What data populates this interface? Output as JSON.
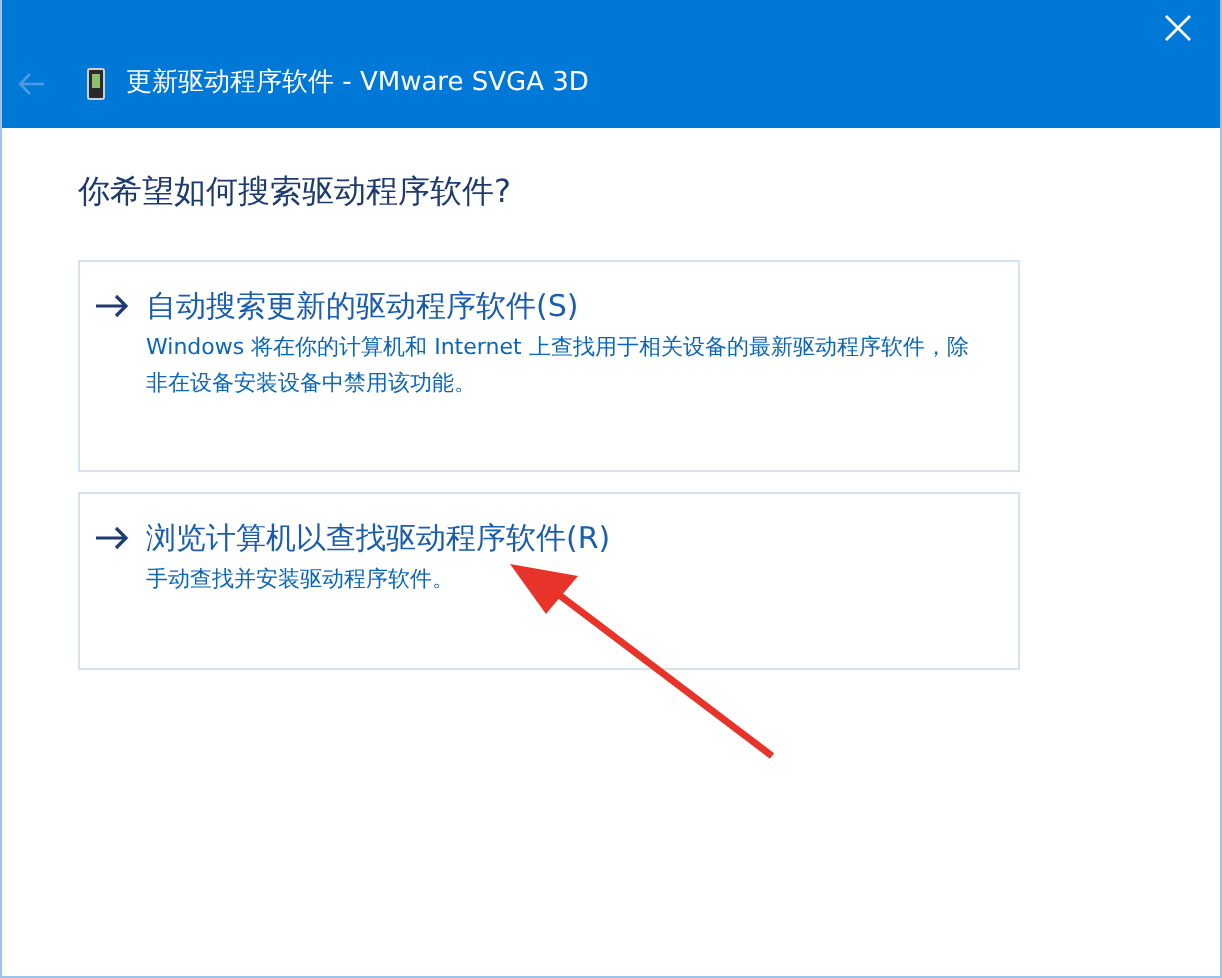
{
  "window": {
    "title": "更新驱动程序软件 - VMware SVGA 3D",
    "back_disabled": true
  },
  "heading": "你希望如何搜索驱动程序软件?",
  "options": [
    {
      "title": "自动搜索更新的驱动程序软件(S)",
      "description": "Windows 将在你的计算机和 Internet 上查找用于相关设备的最新驱动程序软件，除非在设备安装设备中禁用该功能。"
    },
    {
      "title": "浏览计算机以查找驱动程序软件(R)",
      "description": "手动查找并安装驱动程序软件。"
    }
  ]
}
